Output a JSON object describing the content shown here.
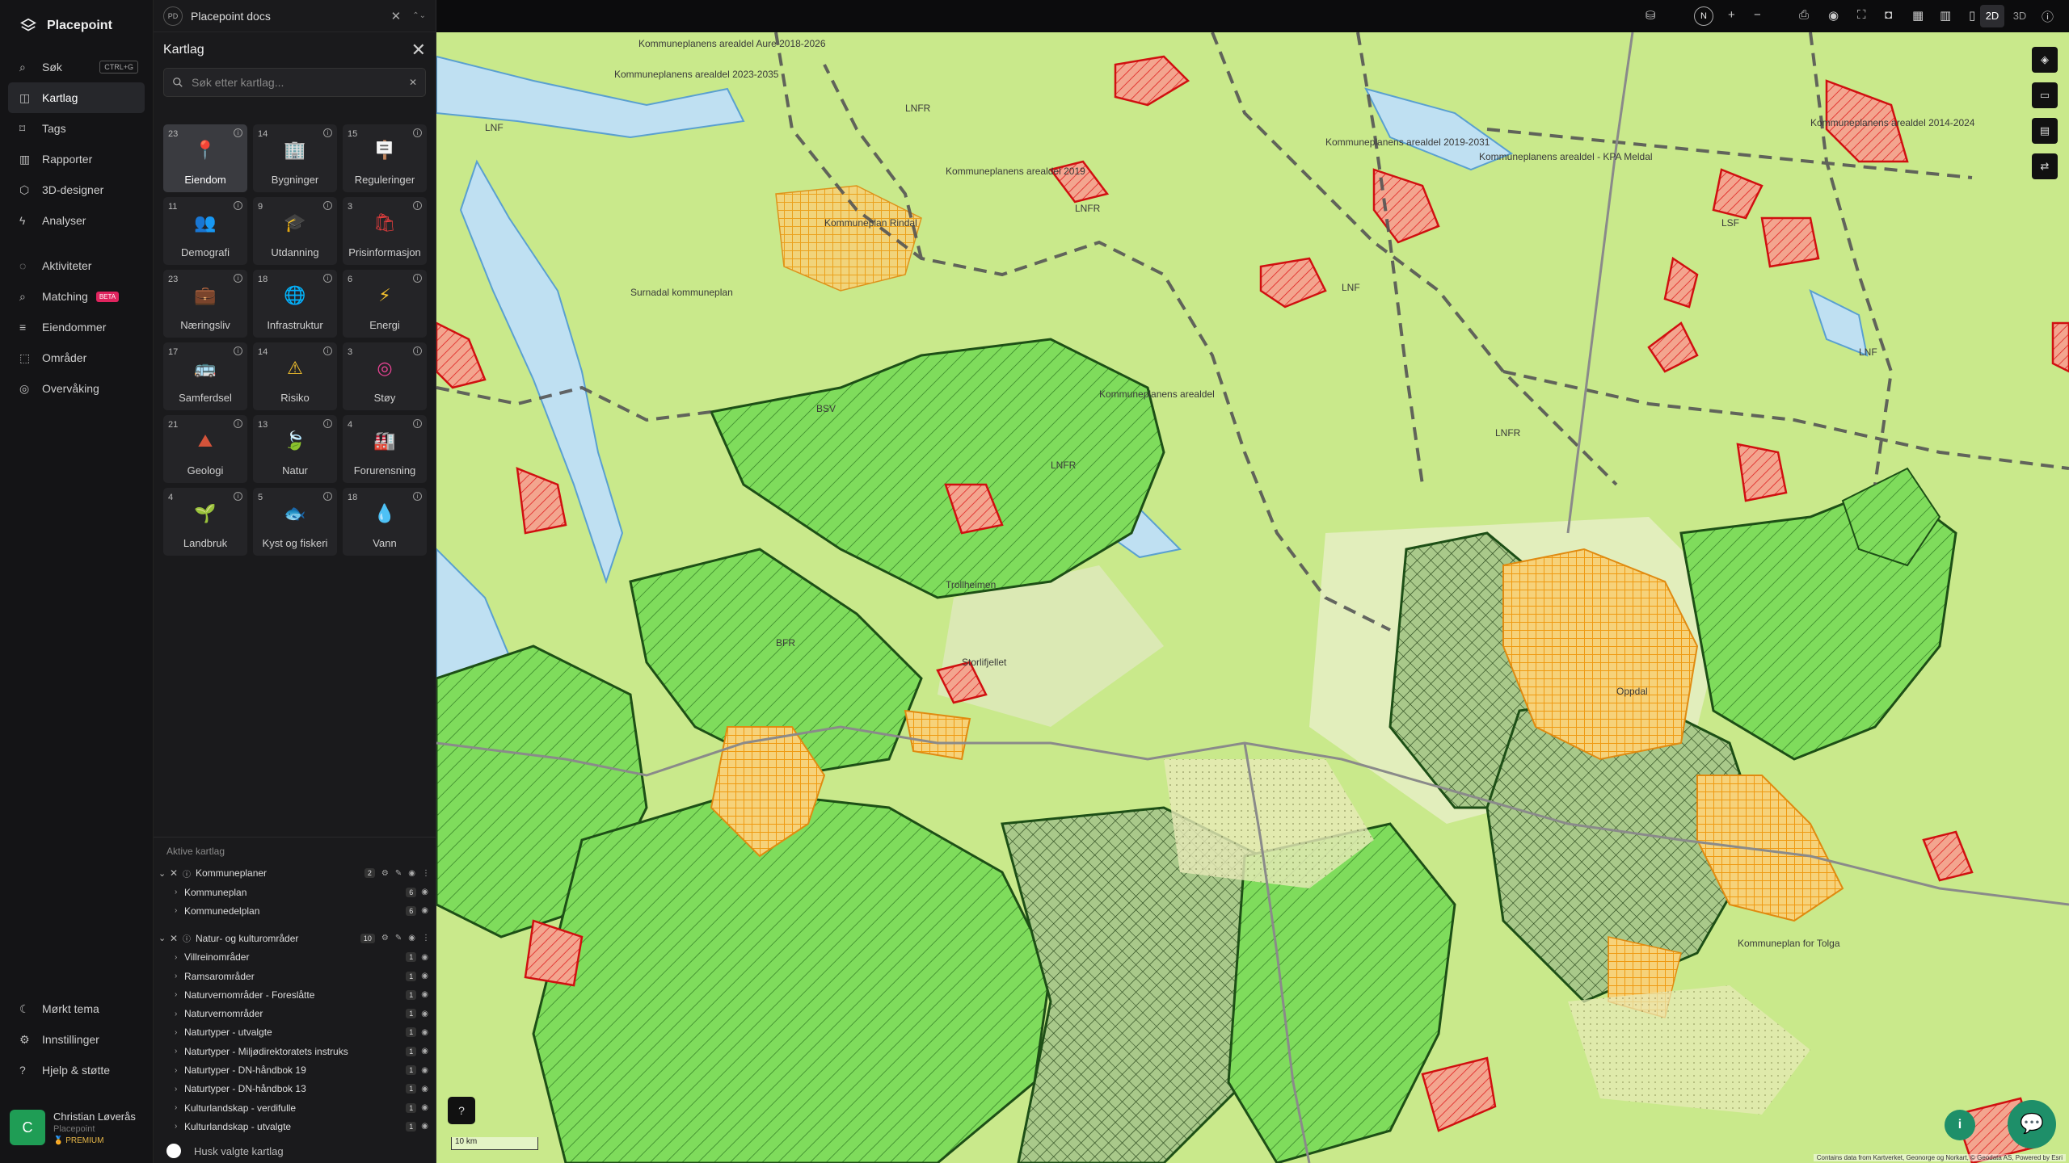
{
  "app": {
    "name": "Placepoint"
  },
  "nav": {
    "items": [
      {
        "label": "Søk",
        "shortcut": "CTRL+G",
        "icon": "search-icon"
      },
      {
        "label": "Kartlag",
        "icon": "layers-icon",
        "active": true
      },
      {
        "label": "Tags",
        "icon": "bookmark-icon"
      },
      {
        "label": "Rapporter",
        "icon": "chart-icon"
      },
      {
        "label": "3D-designer",
        "icon": "cube-icon"
      },
      {
        "label": "Analyser",
        "icon": "bolt-icon"
      }
    ],
    "items2": [
      {
        "label": "Aktiviteter",
        "icon": "activity-icon"
      },
      {
        "label": "Matching",
        "badge": "BETA",
        "icon": "match-icon"
      },
      {
        "label": "Eiendommer",
        "icon": "list-icon"
      },
      {
        "label": "Områder",
        "icon": "area-icon"
      },
      {
        "label": "Overvåking",
        "icon": "monitor-icon"
      }
    ],
    "bottom": [
      {
        "label": "Mørkt tema",
        "icon": "moon-icon"
      },
      {
        "label": "Innstillinger",
        "icon": "gear-icon"
      },
      {
        "label": "Hjelp & støtte",
        "icon": "help-icon"
      }
    ],
    "user": {
      "initial": "C",
      "name": "Christian Løverås",
      "org": "Placepoint",
      "plan": "PREMIUM"
    }
  },
  "tab": {
    "badge": "PD",
    "title": "Placepoint docs"
  },
  "panel": {
    "title": "Kartlag",
    "search_placeholder": "Søk etter kartlag...",
    "categories": [
      {
        "label": "Eiendom",
        "count": "23",
        "glyph": "📍",
        "color": "#e23d3d",
        "active": true
      },
      {
        "label": "Bygninger",
        "count": "14",
        "glyph": "🏢",
        "color": "#7c8cff"
      },
      {
        "label": "Reguleringer",
        "count": "15",
        "glyph": "🪧",
        "color": "#f29a2e"
      },
      {
        "label": "Demografi",
        "count": "11",
        "glyph": "👥",
        "color": "#3fbf6a"
      },
      {
        "label": "Utdanning",
        "count": "9",
        "glyph": "🎓",
        "color": "#4a6cf7"
      },
      {
        "label": "Prisinformasjon",
        "count": "3",
        "glyph": "🛍",
        "color": "#e23d3d"
      },
      {
        "label": "Næringsliv",
        "count": "23",
        "glyph": "💼",
        "color": "#e23d3d"
      },
      {
        "label": "Infrastruktur",
        "count": "18",
        "glyph": "🌐",
        "color": "#5a7cf5"
      },
      {
        "label": "Energi",
        "count": "6",
        "glyph": "⚡",
        "color": "#f2c02e"
      },
      {
        "label": "Samferdsel",
        "count": "17",
        "glyph": "🚌",
        "color": "#e8e8e8"
      },
      {
        "label": "Risiko",
        "count": "14",
        "glyph": "⚠",
        "color": "#f2c02e"
      },
      {
        "label": "Støy",
        "count": "3",
        "glyph": "◎",
        "color": "#e84393"
      },
      {
        "label": "Geologi",
        "count": "21",
        "glyph": "⛰",
        "color": "#d4533a"
      },
      {
        "label": "Natur",
        "count": "13",
        "glyph": "🍃",
        "color": "#3fbf6a"
      },
      {
        "label": "Forurensning",
        "count": "4",
        "glyph": "🏭",
        "color": "#9aa7c7"
      },
      {
        "label": "Landbruk",
        "count": "4",
        "glyph": "🌱",
        "color": "#3fbf6a"
      },
      {
        "label": "Kyst og fiskeri",
        "count": "5",
        "glyph": "🐟",
        "color": "#f29a2e"
      },
      {
        "label": "Vann",
        "count": "18",
        "glyph": "💧",
        "color": "#3aa8f2"
      }
    ],
    "active_title": "Aktive kartlag",
    "groups": [
      {
        "label": "Kommuneplaner",
        "count": "2",
        "rows": [
          {
            "label": "Kommuneplan",
            "count": "6"
          },
          {
            "label": "Kommunedelplan",
            "count": "6"
          }
        ]
      },
      {
        "label": "Natur- og kulturområder",
        "count": "10",
        "rows": [
          {
            "label": "Villreinområder",
            "count": "1"
          },
          {
            "label": "Ramsarområder",
            "count": "1"
          },
          {
            "label": "Naturvernområder - Foreslåtte",
            "count": "1"
          },
          {
            "label": "Naturvernområder",
            "count": "1"
          },
          {
            "label": "Naturtyper - utvalgte",
            "count": "1"
          },
          {
            "label": "Naturtyper - Miljødirektoratets instruks",
            "count": "1"
          },
          {
            "label": "Naturtyper - DN-håndbok 19",
            "count": "1"
          },
          {
            "label": "Naturtyper - DN-håndbok 13",
            "count": "1"
          },
          {
            "label": "Kulturlandskap - verdifulle",
            "count": "1"
          },
          {
            "label": "Kulturlandskap - utvalgte",
            "count": "1"
          }
        ]
      }
    ],
    "remember_label": "Husk valgte kartlag"
  },
  "topbar": {
    "compass": "N",
    "zoom_in": "+",
    "zoom_out": "−",
    "view_2d": "2D",
    "view_3d": "3D",
    "info": "ⓘ"
  },
  "map": {
    "scale": "10 km",
    "attribution": "Contains data from Kartverket, Geonorge og Norkart, © Geodata AS, Powered by Esri",
    "labels": [
      "Kommuneplanens arealdel Aure 2018-2026",
      "Kommuneplanens arealdel 2023-2035",
      "Kommuneplanens arealdel 2019-2031",
      "Kommuneplanens arealdel - KPA Meldal",
      "Kommuneplanens arealdel 2014-2024",
      "Kommuneplan Rindal",
      "Surnadal kommuneplan",
      "Kommuneplanens arealdel",
      "Kommuneplanens arealdel 2019",
      "Kommuneplan for Tolga",
      "LNF",
      "LNFR",
      "BSV",
      "LSF",
      "BFR",
      "Trollheimen",
      "Storlifjellet",
      "Oppdal"
    ]
  },
  "colors": {
    "accent": "#1e8f69",
    "hatch_red": "#e02020",
    "hatch_green": "#2f9e2f",
    "hatch_orange": "#f0a020",
    "map_base": "#c9e98b",
    "water": "#bfe0f2"
  }
}
